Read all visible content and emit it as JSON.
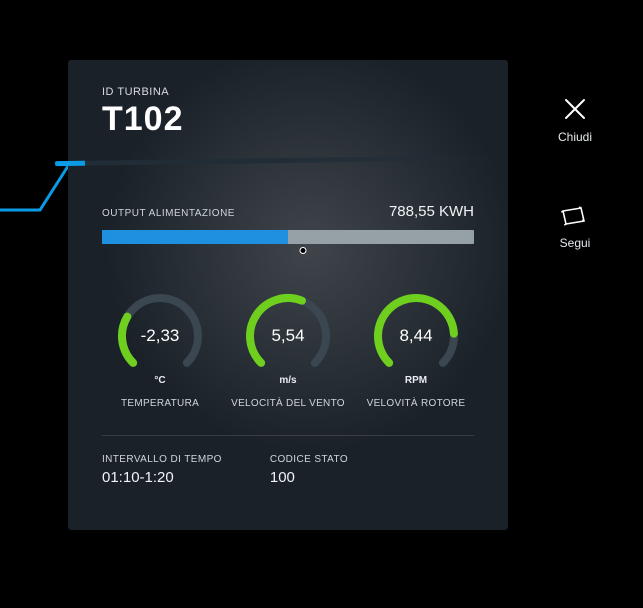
{
  "header": {
    "eyebrow": "ID TURBINA",
    "title": "T102"
  },
  "power": {
    "label": "OUTPUT ALIMENTAZIONE",
    "value_text": "788,55 KWH",
    "fill_pct": 50,
    "marker_pct": 54,
    "marker_label": "o"
  },
  "gauges": [
    {
      "value": "-2,33",
      "unit": "°C",
      "caption": "TEMPERATURA",
      "pct": 28
    },
    {
      "value": "5,54",
      "unit": "m/s",
      "caption": "VELOCITÀ DEL VENTO",
      "pct": 58
    },
    {
      "value": "8,44",
      "unit": "RPM",
      "caption": "VELOVITÀ ROTORE",
      "pct": 82
    }
  ],
  "footer": {
    "interval_label": "INTERVALLO DI TEMPO",
    "interval_value": "01:10-1:20",
    "code_label": "CODICE STATO",
    "code_value": "100"
  },
  "actions": {
    "close": "Chiudi",
    "follow": "Segui"
  },
  "colors": {
    "accent": "#1f8fe0",
    "gauge": "#6fcf1f",
    "track": "#3a4750"
  }
}
